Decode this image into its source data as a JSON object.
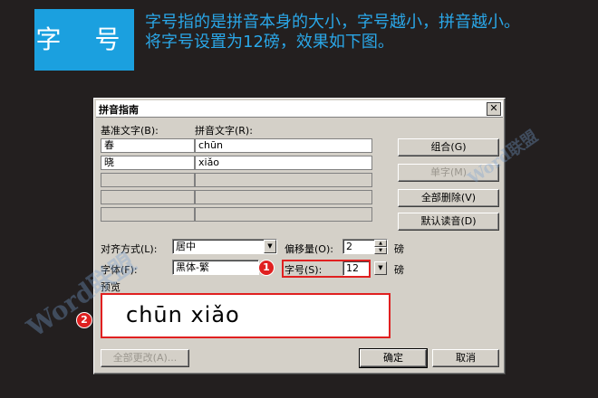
{
  "header": {
    "badge": "字 号",
    "desc_line1": "字号指的是拼音本身的大小，字号越小，拼音越小。",
    "desc_line2": "将字号设置为12磅，效果如下图。"
  },
  "dialog": {
    "title": "拼音指南",
    "close_glyph": "✕",
    "base_text_label": "基准文字(B):",
    "pinyin_text_label": "拼音文字(R):",
    "rows": [
      {
        "base": "春",
        "pinyin": "chūn"
      },
      {
        "base": "晓",
        "pinyin": "xiǎo"
      },
      {
        "base": "",
        "pinyin": ""
      },
      {
        "base": "",
        "pinyin": ""
      },
      {
        "base": "",
        "pinyin": ""
      }
    ],
    "buttons": {
      "combine": "组合(G)",
      "single": "单字(M)",
      "delete_all": "全部删除(V)",
      "default_reading": "默认读音(D)",
      "change_all": "全部更改(A)...",
      "ok": "确定",
      "cancel": "取消"
    },
    "align_label": "对齐方式(L):",
    "align_value": "居中",
    "offset_label": "偏移量(O):",
    "offset_value": "2",
    "offset_unit": "磅",
    "font_label": "字体(F):",
    "font_value": "黑体-繁",
    "size_label": "字号(S):",
    "size_value": "12",
    "size_unit": "磅",
    "preview_label": "预览",
    "preview_text": "chūn xiǎo"
  },
  "markers": {
    "m1": "1",
    "m2": "2"
  },
  "watermark": {
    "brand_latin": "Word",
    "brand_cn": "联盟"
  },
  "colors": {
    "accent": "#1ba0df",
    "highlight": "#e02020",
    "background": "#231f1f"
  }
}
